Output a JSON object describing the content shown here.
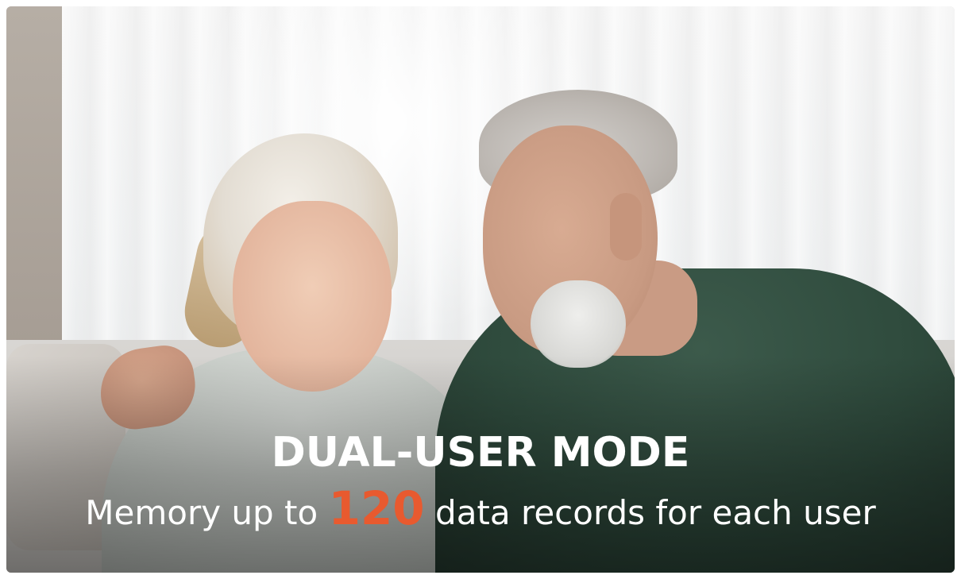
{
  "headline": "DUAL-USER MODE",
  "subline": {
    "before": "Memory up to",
    "number": "120",
    "after": "data records for each user"
  },
  "colors": {
    "text": "#ffffff",
    "accent": "#e85a2f"
  }
}
